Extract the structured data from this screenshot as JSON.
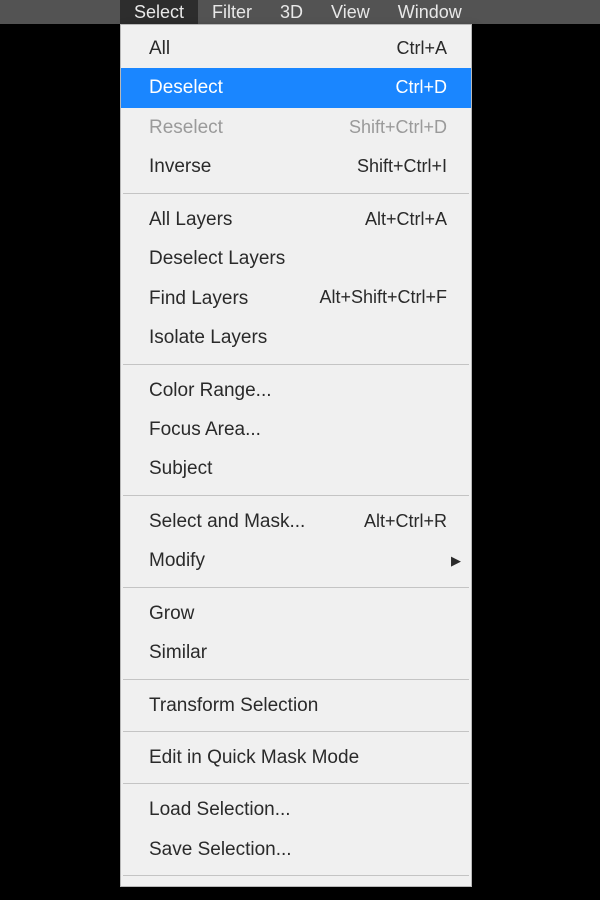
{
  "menubar": {
    "items": [
      {
        "label": "Select",
        "active": true
      },
      {
        "label": "Filter",
        "active": false
      },
      {
        "label": "3D",
        "active": false
      },
      {
        "label": "View",
        "active": false
      },
      {
        "label": "Window",
        "active": false
      }
    ]
  },
  "dropdown": {
    "groups": [
      [
        {
          "label": "All",
          "shortcut": "Ctrl+A",
          "state": "normal"
        },
        {
          "label": "Deselect",
          "shortcut": "Ctrl+D",
          "state": "highlighted"
        },
        {
          "label": "Reselect",
          "shortcut": "Shift+Ctrl+D",
          "state": "disabled"
        },
        {
          "label": "Inverse",
          "shortcut": "Shift+Ctrl+I",
          "state": "normal"
        }
      ],
      [
        {
          "label": "All Layers",
          "shortcut": "Alt+Ctrl+A",
          "state": "normal"
        },
        {
          "label": "Deselect Layers",
          "shortcut": "",
          "state": "normal"
        },
        {
          "label": "Find Layers",
          "shortcut": "Alt+Shift+Ctrl+F",
          "state": "normal"
        },
        {
          "label": "Isolate Layers",
          "shortcut": "",
          "state": "normal"
        }
      ],
      [
        {
          "label": "Color Range...",
          "shortcut": "",
          "state": "normal"
        },
        {
          "label": "Focus Area...",
          "shortcut": "",
          "state": "normal"
        },
        {
          "label": "Subject",
          "shortcut": "",
          "state": "normal"
        }
      ],
      [
        {
          "label": "Select and Mask...",
          "shortcut": "Alt+Ctrl+R",
          "state": "normal"
        },
        {
          "label": "Modify",
          "shortcut": "",
          "state": "normal",
          "submenu": true
        }
      ],
      [
        {
          "label": "Grow",
          "shortcut": "",
          "state": "normal"
        },
        {
          "label": "Similar",
          "shortcut": "",
          "state": "normal"
        }
      ],
      [
        {
          "label": "Transform Selection",
          "shortcut": "",
          "state": "normal"
        }
      ],
      [
        {
          "label": "Edit in Quick Mask Mode",
          "shortcut": "",
          "state": "normal"
        }
      ],
      [
        {
          "label": "Load Selection...",
          "shortcut": "",
          "state": "normal"
        },
        {
          "label": "Save Selection...",
          "shortcut": "",
          "state": "normal"
        }
      ]
    ]
  }
}
